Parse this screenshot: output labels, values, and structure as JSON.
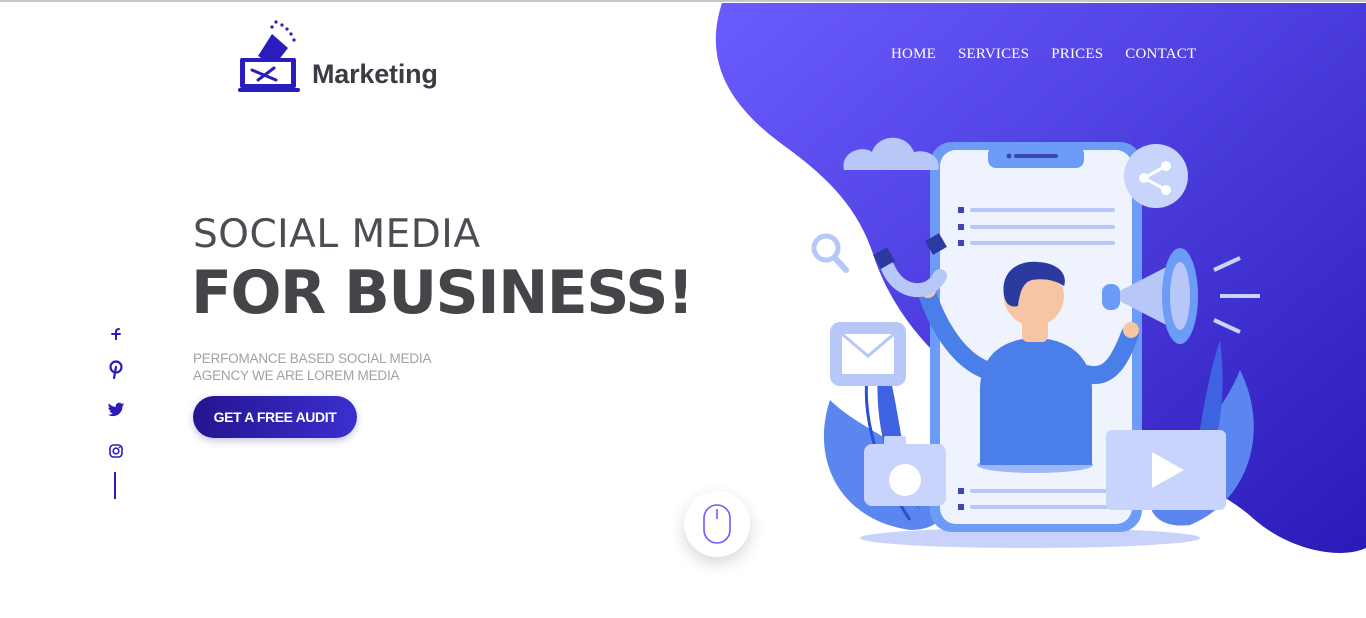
{
  "brand": {
    "name": "Marketing"
  },
  "nav": [
    {
      "label": "HOME"
    },
    {
      "label": "SERVICES"
    },
    {
      "label": "PRICES"
    },
    {
      "label": "CONTACT"
    }
  ],
  "hero": {
    "subtitle": "SOCIAL MEDIA",
    "title": "FOR BUSINESS!",
    "description": "PERFOMANCE BASED SOCIAL MEDIA AGENCY WE ARE LOREM MEDIA",
    "cta_label": "GET A FREE AUDIT"
  },
  "social": [
    "facebook-icon",
    "pinterest-icon",
    "twitter-icon",
    "instagram-icon"
  ],
  "colors": {
    "accent": "#2a1dbd",
    "blob_start": "#6b5cff",
    "blob_end": "#2a1ab8",
    "text_dark": "#444449",
    "text_muted": "#a0a0a8"
  }
}
